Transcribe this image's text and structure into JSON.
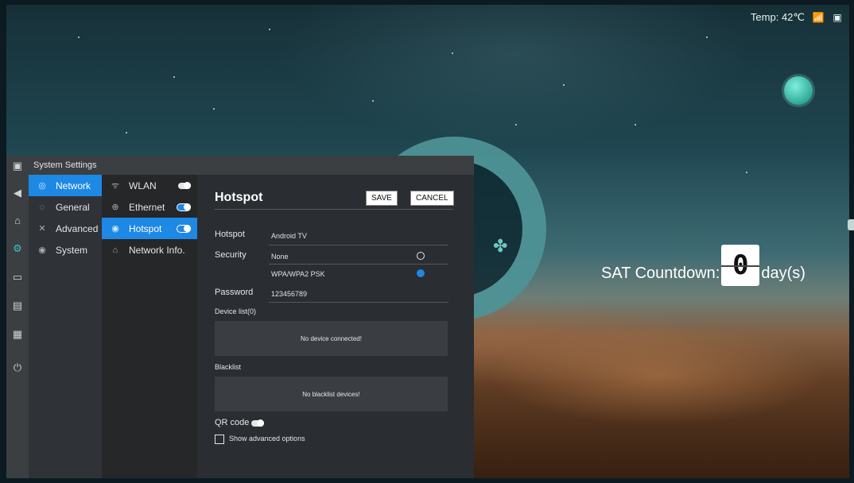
{
  "status": {
    "temp_label": "Temp:",
    "temp_value": "42℃",
    "icons": [
      "wireless-icon",
      "screen-icon"
    ]
  },
  "widget": {
    "countdown_label": "SAT Countdown:",
    "countdown_value": "0",
    "countdown_unit": "day(s)"
  },
  "settings": {
    "title": "System Settings",
    "left_rail_icons": [
      "back-icon",
      "home-icon",
      "settings-gear-icon",
      "folder-icon",
      "monitor-icon",
      "keyboard-icon",
      "power-icon"
    ],
    "categories": [
      {
        "label": "Network",
        "icon": "network-icon",
        "active": true
      },
      {
        "label": "General",
        "icon": "general-icon",
        "active": false
      },
      {
        "label": "Advanced",
        "icon": "advanced-icon",
        "active": false
      },
      {
        "label": "System",
        "icon": "system-icon",
        "active": false
      }
    ],
    "network_items": [
      {
        "label": "WLAN",
        "icon": "wifi-icon",
        "toggle": "off",
        "active": false
      },
      {
        "label": "Ethernet",
        "icon": "ethernet-icon",
        "toggle": "on",
        "active": false
      },
      {
        "label": "Hotspot",
        "icon": "hotspot-icon",
        "toggle": "on",
        "active": true
      },
      {
        "label": "Network Info.",
        "icon": "info-icon",
        "toggle": null,
        "active": false
      }
    ],
    "hotspot": {
      "heading": "Hotspot",
      "save_label": "SAVE",
      "cancel_label": "CANCEL",
      "hotspot_label": "Hotspot",
      "hotspot_name": "Android TV",
      "security_label": "Security",
      "security_options": [
        {
          "label": "None",
          "selected": false
        },
        {
          "label": "WPA/WPA2 PSK",
          "selected": true
        }
      ],
      "password_label": "Password",
      "password_value": "123456789",
      "device_list_label": "Device list(0)",
      "device_list_empty": "No device connected!",
      "blacklist_label": "Blacklist",
      "blacklist_empty": "No blacklist devices!",
      "qr_label": "QR code",
      "qr_toggle": "off",
      "advanced_label": "Show advanced options",
      "advanced_checked": false
    }
  },
  "colors": {
    "accent": "#1e88e5",
    "teal": "#3ec1c0",
    "panel": "#2a2d31"
  }
}
